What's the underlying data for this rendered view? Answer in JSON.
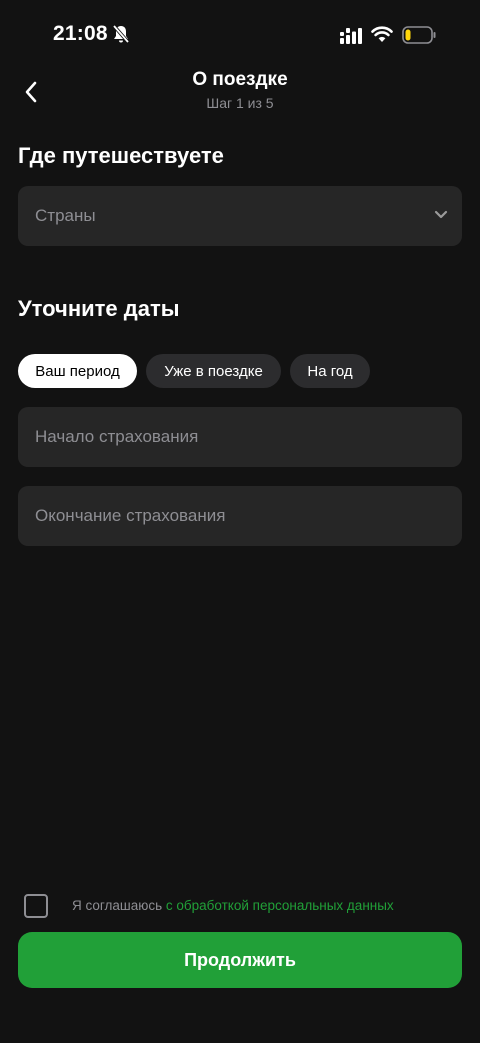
{
  "status_bar": {
    "time": "21:08",
    "icons": [
      "bell-slash-icon",
      "signal-icon",
      "wifi-icon",
      "battery-icon"
    ],
    "battery_color": "#ffd60a"
  },
  "header": {
    "back_icon": "chevron-left-icon",
    "title": "О поездке",
    "subtitle": "Шаг 1 из 5"
  },
  "destination": {
    "title": "Где путешествуете",
    "placeholder": "Страны",
    "icon": "chevron-down-icon"
  },
  "dates": {
    "title": "Уточните даты",
    "tabs": [
      {
        "label": "Ваш период",
        "active": true
      },
      {
        "label": "Уже в поездке",
        "active": false
      },
      {
        "label": "На год",
        "active": false
      }
    ],
    "start_placeholder": "Начало страхования",
    "end_placeholder": "Окончание страхования"
  },
  "consent": {
    "text": "Я соглашаюсь ",
    "link": "с обработкой персональных данных",
    "checked": false
  },
  "continue_label": "Продолжить",
  "colors": {
    "background": "#121212",
    "field": "#262626",
    "accent": "#21a038",
    "muted": "#8e8e93"
  }
}
